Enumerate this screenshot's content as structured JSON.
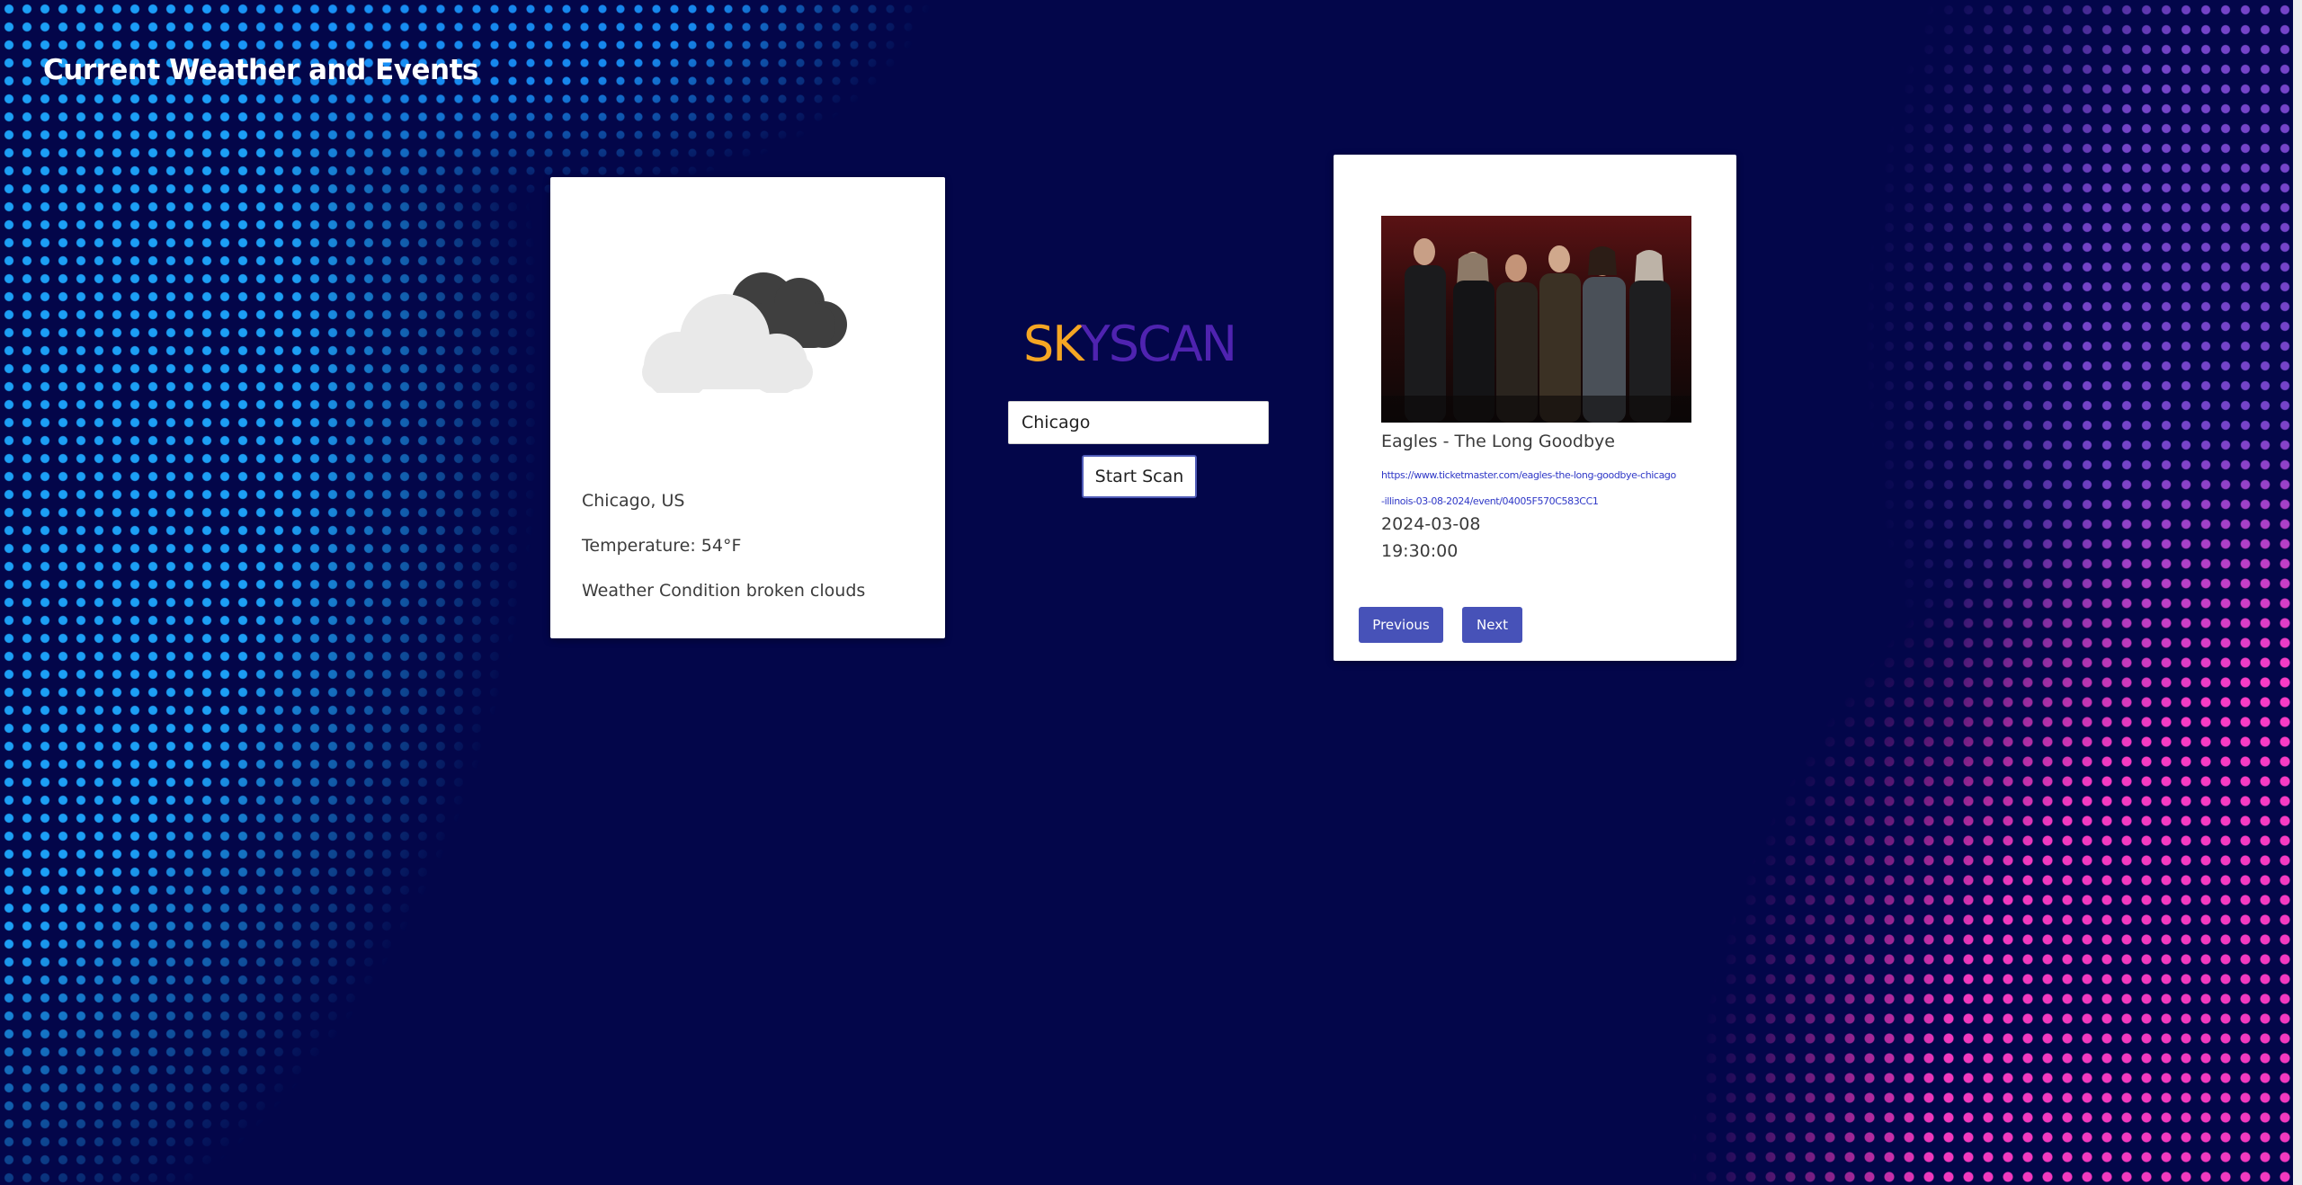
{
  "header": {
    "title": "Current Weather and Events"
  },
  "weather": {
    "icon": "broken-clouds-icon",
    "location": "Chicago, US",
    "temperature": "Temperature: 54°F",
    "condition": "Weather Condition broken clouds"
  },
  "search": {
    "brand_part1": "SK",
    "brand_part2": "YSCAN",
    "input_value": "Chicago",
    "button_label": "Start Scan"
  },
  "event": {
    "title": "Eagles - The Long Goodbye",
    "url": "https://www.ticketmaster.com/eagles-the-long-goodbye-chicago-illinois-03-08-2024/event/04005F570C583CC1",
    "date": "2024-03-08",
    "time": "19:30:00",
    "prev_label": "Previous",
    "next_label": "Next"
  },
  "colors": {
    "background": "#03064a",
    "brand_orange": "#f5a623",
    "brand_purple": "#4f23b0",
    "button_blue": "#4752b8",
    "link_blue": "#2f38c7"
  }
}
